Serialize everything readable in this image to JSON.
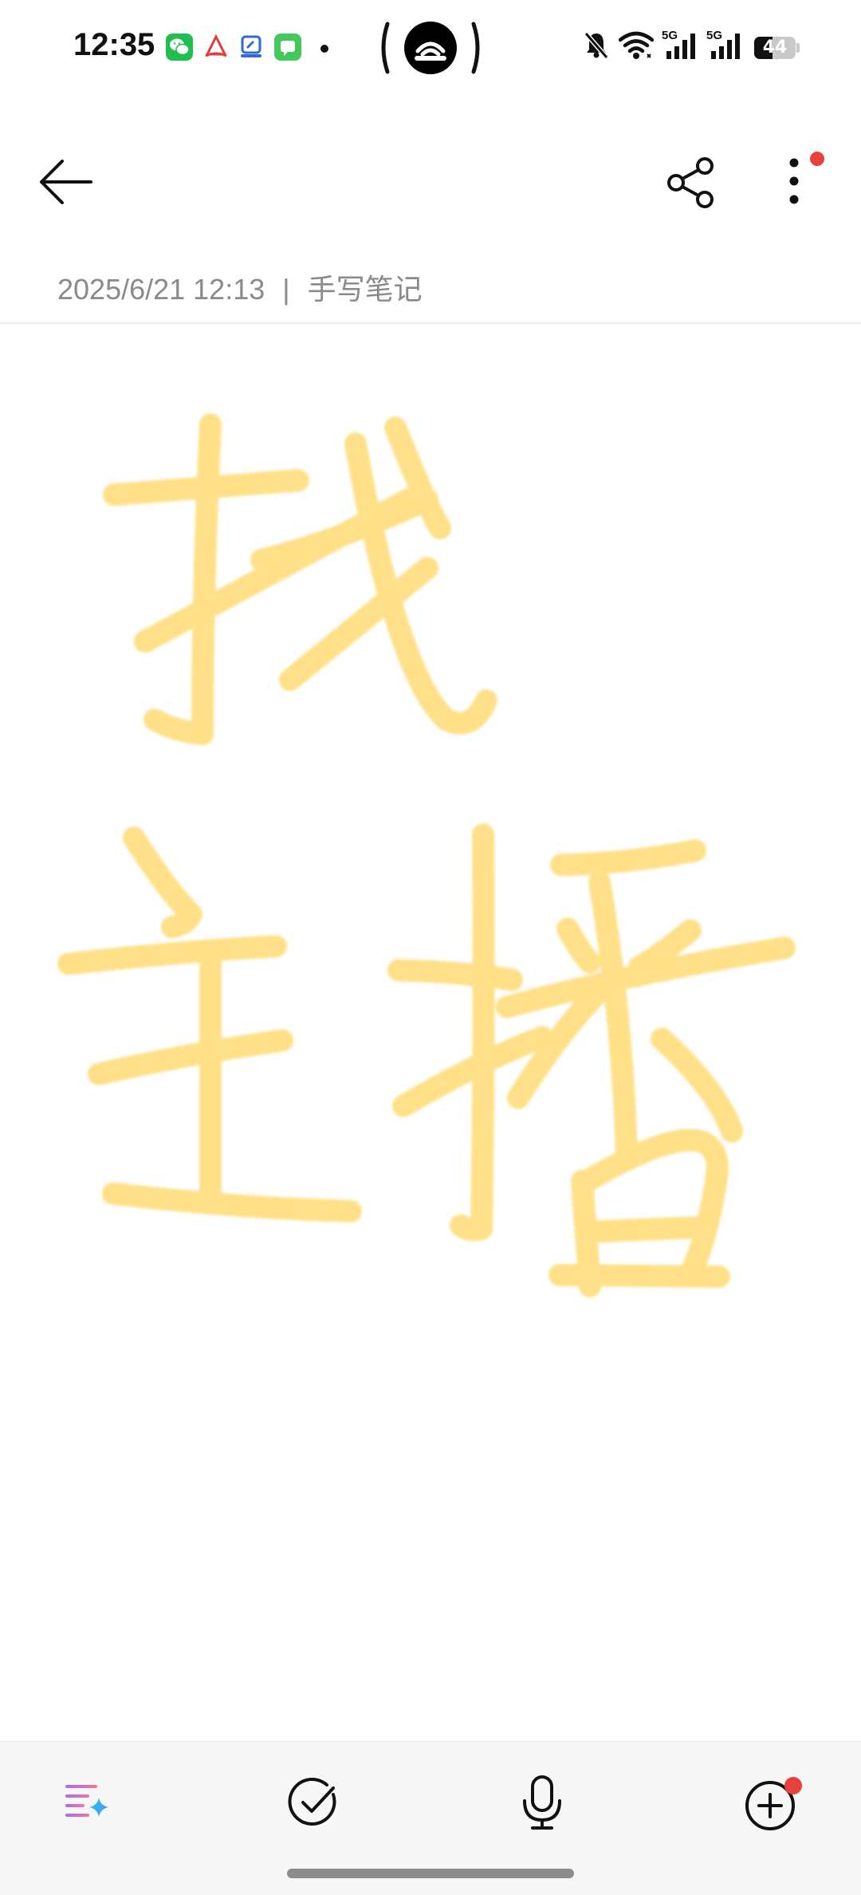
{
  "status_bar": {
    "time": "12:35",
    "battery_level": 44,
    "battery_text": "44",
    "icons": [
      "wechat-icon",
      "app-icon",
      "app-icon",
      "messages-icon",
      "hotspot-icon",
      "mute-icon",
      "wifi-icon",
      "signal-5g-icon",
      "signal-5g-icon",
      "battery-icon"
    ],
    "network_labels": [
      "5G",
      "5G"
    ]
  },
  "app_bar": {
    "back_icon": "arrow-left-icon",
    "share_icon": "share-icon",
    "more_icon": "more-vertical-icon",
    "more_badge": true
  },
  "note": {
    "date": "2025/6/21 12:13",
    "separator": "|",
    "type": "手写笔记"
  },
  "handwriting": {
    "ink_color": "#FFD45A",
    "characters": [
      "找",
      "主",
      "播"
    ]
  },
  "bottom_toolbar": {
    "items": [
      {
        "icon": "ai-format-icon"
      },
      {
        "icon": "checkmark-circle-icon"
      },
      {
        "icon": "microphone-icon"
      },
      {
        "icon": "add-circle-icon",
        "badge": true
      }
    ]
  },
  "colors": {
    "badge": "#E8403A",
    "meta_text": "#8A8A8A",
    "ink": "#FFD45A",
    "ink_dark": "#F5BC2B"
  }
}
